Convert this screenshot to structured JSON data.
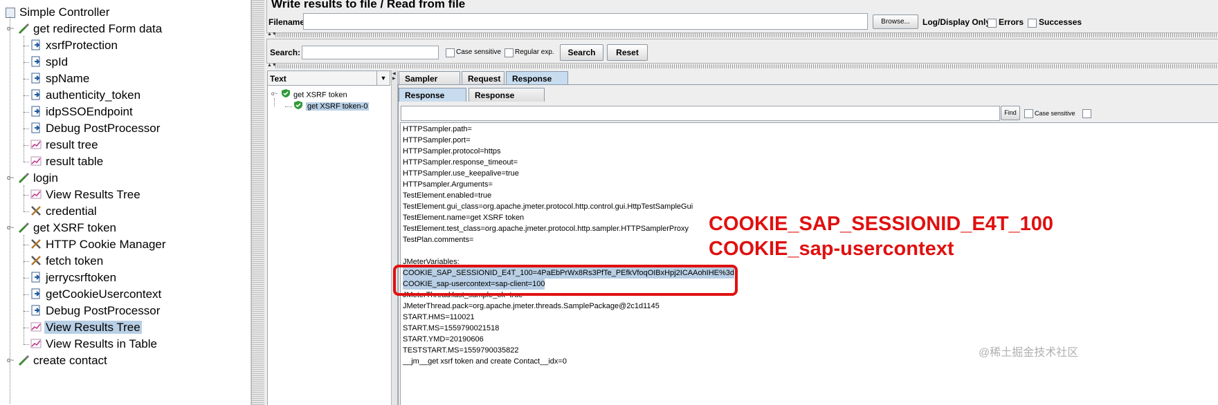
{
  "tree": {
    "root": "Simple Controller",
    "items": [
      {
        "label": "get redirected Form data",
        "icon": "sampler-pipette-icon",
        "level": 1
      },
      {
        "label": "xsrfProtection",
        "icon": "postprocessor-icon",
        "level": 2
      },
      {
        "label": "spId",
        "icon": "postprocessor-icon",
        "level": 2
      },
      {
        "label": "spName",
        "icon": "postprocessor-icon",
        "level": 2
      },
      {
        "label": "authenticity_token",
        "icon": "postprocessor-icon",
        "level": 2
      },
      {
        "label": "idpSSOEndpoint",
        "icon": "postprocessor-icon",
        "level": 2
      },
      {
        "label": "Debug PostProcessor",
        "icon": "postprocessor-icon",
        "level": 2
      },
      {
        "label": "result tree",
        "icon": "listener-graph-icon",
        "level": 2
      },
      {
        "label": "result table",
        "icon": "listener-graph-icon",
        "level": 2
      },
      {
        "label": "login",
        "icon": "sampler-pipette-icon",
        "level": 1
      },
      {
        "label": "View Results Tree",
        "icon": "listener-graph-icon",
        "level": 2
      },
      {
        "label": "credential",
        "icon": "config-tools-icon",
        "level": 2
      },
      {
        "label": "get XSRF token",
        "icon": "sampler-pipette-icon",
        "level": 1
      },
      {
        "label": "HTTP Cookie Manager",
        "icon": "config-tools-icon",
        "level": 2
      },
      {
        "label": "fetch token",
        "icon": "config-tools-icon",
        "level": 2
      },
      {
        "label": "jerrycsrftoken",
        "icon": "postprocessor-icon",
        "level": 2
      },
      {
        "label": "getCookieUsercontext",
        "icon": "postprocessor-icon",
        "level": 2
      },
      {
        "label": "Debug PostProcessor",
        "icon": "postprocessor-icon",
        "level": 2
      },
      {
        "label": "View Results Tree",
        "icon": "listener-graph-icon",
        "level": 2,
        "selected": true
      },
      {
        "label": "View Results in Table",
        "icon": "listener-graph-icon",
        "level": 2
      },
      {
        "label": "create contact",
        "icon": "sampler-pipette-icon",
        "level": 1
      }
    ]
  },
  "file_section": {
    "title": "Write results to file / Read from file",
    "filename_label": "Filename",
    "filename_value": "",
    "browse_label": "Browse...",
    "log_display_label": "Log/Display Only:",
    "errors_label": "Errors",
    "successes_label": "Successes"
  },
  "search": {
    "label": "Search:",
    "value": "",
    "case_sensitive_label": "Case sensitive",
    "regex_label": "Regular exp.",
    "search_button": "Search",
    "reset_button": "Reset"
  },
  "results": {
    "renderer": "Text",
    "nodes": [
      {
        "label": "get XSRF token"
      },
      {
        "label": "get XSRF token-0",
        "selected": true
      }
    ]
  },
  "tabs": [
    "Sampler result",
    "Request",
    "Response data"
  ],
  "active_tab": "Response data",
  "subtabs": [
    "Response Body",
    "Response headers"
  ],
  "active_subtab": "Response Body",
  "find": {
    "value": "",
    "button": "Find",
    "case_sensitive_label": "Case sensitive"
  },
  "response_lines": [
    "HTTPSampler.path=",
    "HTTPSampler.port=",
    "HTTPSampler.protocol=https",
    "HTTPSampler.response_timeout=",
    "HTTPSampler.use_keepalive=true",
    "HTTPsampler.Arguments=",
    "TestElement.enabled=true",
    "TestElement.gui_class=org.apache.jmeter.protocol.http.control.gui.HttpTestSampleGui",
    "TestElement.name=get XSRF token",
    "TestElement.test_class=org.apache.jmeter.protocol.http.sampler.HTTPSamplerProxy",
    "TestPlan.comments=",
    "",
    "JMeterVariables:",
    "COOKIE_SAP_SESSIONID_E4T_100=4PaEbPrWx8Rs3PfTe_PEfkVfoqOIBxHpj2ICAAohIHE%3d",
    "COOKIE_sap-usercontext=sap-client=100",
    "JMeterThread.last_sample_ok=true",
    "JMeterThread.pack=org.apache.jmeter.threads.SamplePackage@2c1d1145",
    "START.HMS=110021",
    "START.MS=1559790021518",
    "START.YMD=20190606",
    "TESTSTART.MS=1559790035822",
    "__jm__get xsrf token and create Contact__idx=0"
  ],
  "highlighted_lines": [
    13,
    14
  ],
  "annotation": {
    "line1": "COOKIE_SAP_SESSIONID_E4T_100",
    "line2": "COOKIE_sap-usercontext",
    "color": "#e01010"
  },
  "watermark": "@稀土掘金技术社区",
  "colors": {
    "selection": "#b8cfe5",
    "tab_active": "#c8dcef",
    "panel_bg": "#eeeeee"
  }
}
